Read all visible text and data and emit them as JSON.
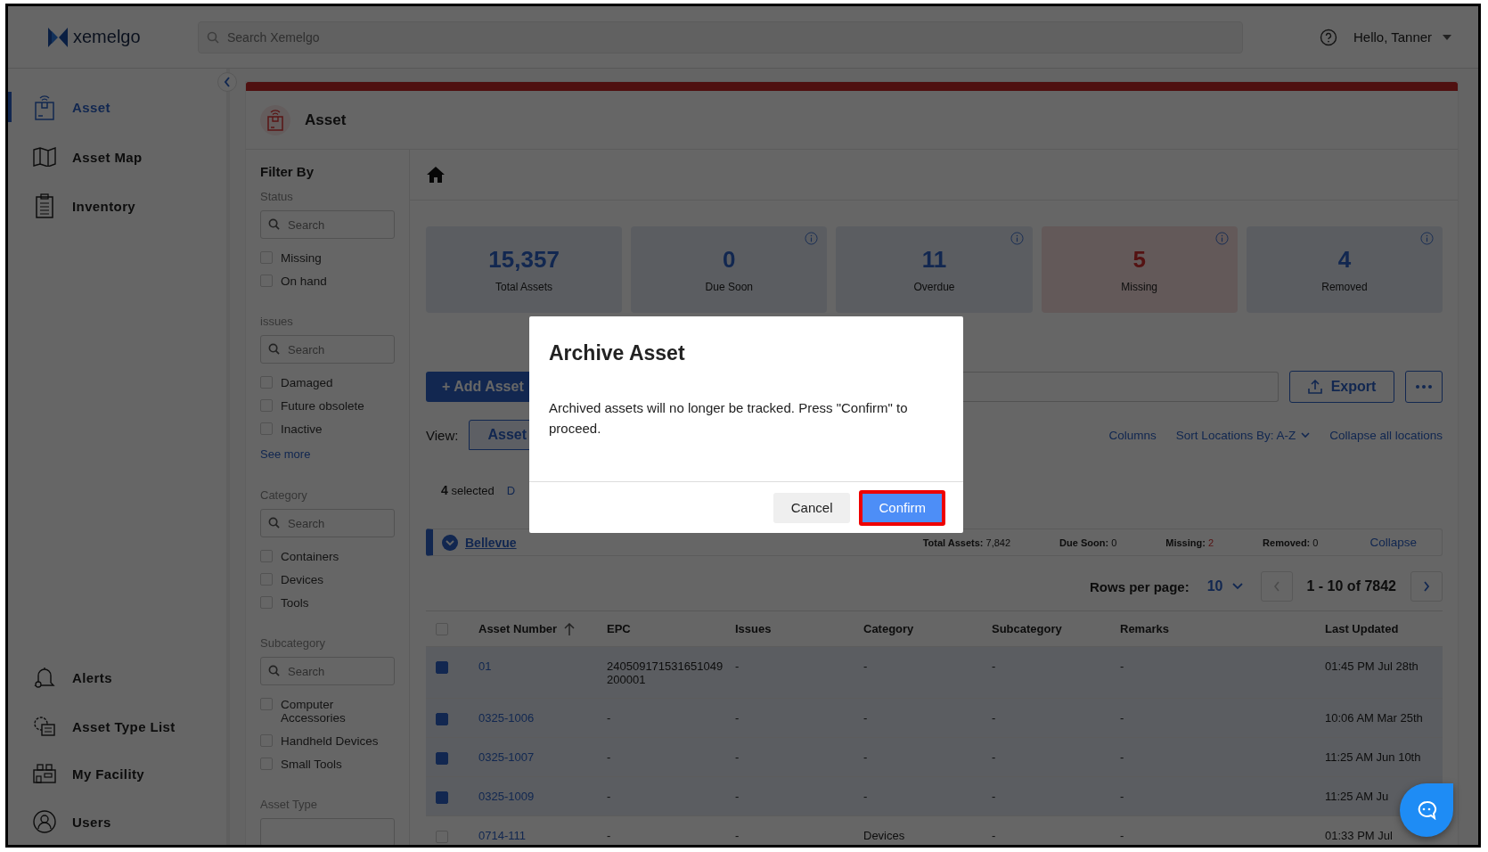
{
  "brand": {
    "name": "xemelgo"
  },
  "search": {
    "placeholder": "Search Xemelgo"
  },
  "user": {
    "greeting": "Hello, Tanner"
  },
  "nav": {
    "top": [
      {
        "label": "Asset",
        "selected": true
      },
      {
        "label": "Asset Map",
        "selected": false
      },
      {
        "label": "Inventory",
        "selected": false
      }
    ],
    "bottom": [
      {
        "label": "Alerts",
        "selected": false
      },
      {
        "label": "Asset Type List",
        "selected": false
      },
      {
        "label": "My Facility",
        "selected": false
      },
      {
        "label": "Users",
        "selected": false
      }
    ]
  },
  "page": {
    "title": "Asset"
  },
  "filters": {
    "title": "Filter By",
    "groups": [
      {
        "label": "Status",
        "placeholder": "Search",
        "options": [
          {
            "label": "Missing",
            "checked": false
          },
          {
            "label": "On hand",
            "checked": false
          }
        ]
      },
      {
        "label": "issues",
        "placeholder": "Search",
        "options": [
          {
            "label": "Damaged",
            "checked": false
          },
          {
            "label": "Future obsolete",
            "checked": false
          },
          {
            "label": "Inactive",
            "checked": false
          }
        ],
        "see_more": "See more"
      },
      {
        "label": "Category",
        "placeholder": "Search",
        "options": [
          {
            "label": "Containers",
            "checked": false
          },
          {
            "label": "Devices",
            "checked": false
          },
          {
            "label": "Tools",
            "checked": false
          }
        ]
      },
      {
        "label": "Subcategory",
        "placeholder": "Search",
        "options": [
          {
            "label": "Computer Accessories",
            "checked": false
          },
          {
            "label": "Handheld Devices",
            "checked": false
          },
          {
            "label": "Small Tools",
            "checked": false
          }
        ]
      },
      {
        "label": "Asset Type"
      }
    ]
  },
  "metrics": [
    {
      "value": "15,357",
      "label": "Total Assets",
      "info": false,
      "alert": false
    },
    {
      "value": "0",
      "label": "Due Soon",
      "info": true,
      "alert": false
    },
    {
      "value": "11",
      "label": "Overdue",
      "info": true,
      "alert": false
    },
    {
      "value": "5",
      "label": "Missing",
      "info": true,
      "alert": true
    },
    {
      "value": "4",
      "label": "Removed",
      "info": true,
      "alert": false
    }
  ],
  "toolbar": {
    "add": "+ Add Asset",
    "export": "Export",
    "view_label": "View:",
    "view": "Asset",
    "links": [
      "Columns",
      "Sort Locations By: A-Z",
      "Collapse all locations"
    ],
    "selected_count": "4",
    "selected_label": "selected",
    "action": "D"
  },
  "location": {
    "name": "Bellevue",
    "expanded": true,
    "stats": [
      {
        "label": "Total Assets:",
        "value": "7,842",
        "alert": false
      },
      {
        "label": "Due Soon:",
        "value": "0",
        "alert": false
      },
      {
        "label": "Missing:",
        "value": "2",
        "alert": true
      },
      {
        "label": "Removed:",
        "value": "0",
        "alert": false
      }
    ],
    "action": "Collapse"
  },
  "pagination": {
    "rows_label": "Rows per page:",
    "rows_value": "10",
    "range": "1 - 10 of 7842"
  },
  "table": {
    "all_selected": false,
    "columns": [
      {
        "label": "Asset Number",
        "sorted": true
      },
      {
        "label": "EPC",
        "sorted": false
      },
      {
        "label": "Issues",
        "sorted": false
      },
      {
        "label": "Category",
        "sorted": false
      },
      {
        "label": "Subcategory",
        "sorted": false
      },
      {
        "label": "Remarks",
        "sorted": false
      },
      {
        "label": "Last Updated",
        "sorted": false
      }
    ],
    "rows": [
      {
        "selected": true,
        "cells": [
          "01",
          "240509171531651049200001",
          "-",
          "-",
          "-",
          "-",
          "01:45 PM Jul 28th"
        ]
      },
      {
        "selected": true,
        "cells": [
          "0325-1006",
          "-",
          "-",
          "-",
          "-",
          "-",
          "10:06 AM Mar 25th"
        ]
      },
      {
        "selected": true,
        "cells": [
          "0325-1007",
          "-",
          "-",
          "-",
          "-",
          "-",
          "11:25 AM Jun 10th"
        ]
      },
      {
        "selected": true,
        "cells": [
          "0325-1009",
          "-",
          "-",
          "-",
          "-",
          "-",
          "11:25 AM Ju"
        ]
      },
      {
        "selected": false,
        "cells": [
          "0714-111",
          "-",
          "-",
          "Devices",
          "-",
          "-",
          "01:33 PM Jul"
        ]
      }
    ]
  },
  "modal": {
    "title": "Archive Asset",
    "body": "Archived assets will no longer be tracked. Press \"Confirm\" to proceed.",
    "cancel": "Cancel",
    "confirm": "Confirm",
    "confirm_highlighted": true
  }
}
